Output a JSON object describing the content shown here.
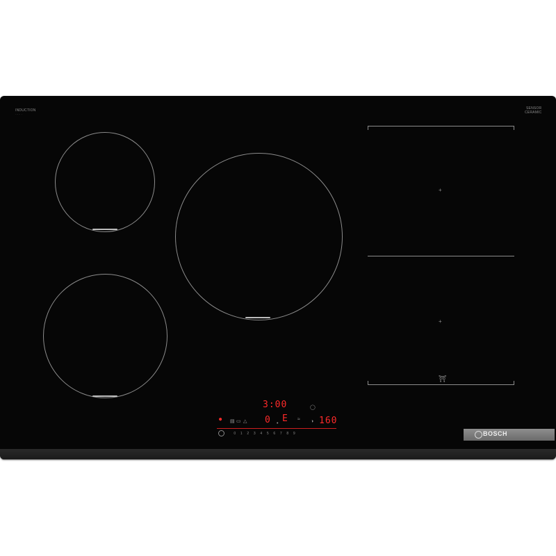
{
  "branding": {
    "induction_label": "INDUCTION",
    "sensor_label_line1": "SENSOR",
    "sensor_label_line2": "CERAMIC",
    "brand": "BOSCH"
  },
  "displays": {
    "timer": "3:00",
    "left_zone_level": "0",
    "right_zone_level": "E",
    "temperature": "160"
  },
  "power_scale": [
    "0",
    "1",
    "2",
    "3",
    "4",
    "5",
    "6",
    "7",
    "8",
    "9"
  ],
  "icons": {
    "power": "power-icon",
    "pan_sensor": "pan-icon",
    "flex_zone_pan": "pan-icon",
    "timer": "timer-icon"
  },
  "colors": {
    "glass": "#060606",
    "display_red": "#ff2a2a",
    "zone_outline": "#8c8c8c",
    "logo_plate": "#7d7d7d"
  }
}
